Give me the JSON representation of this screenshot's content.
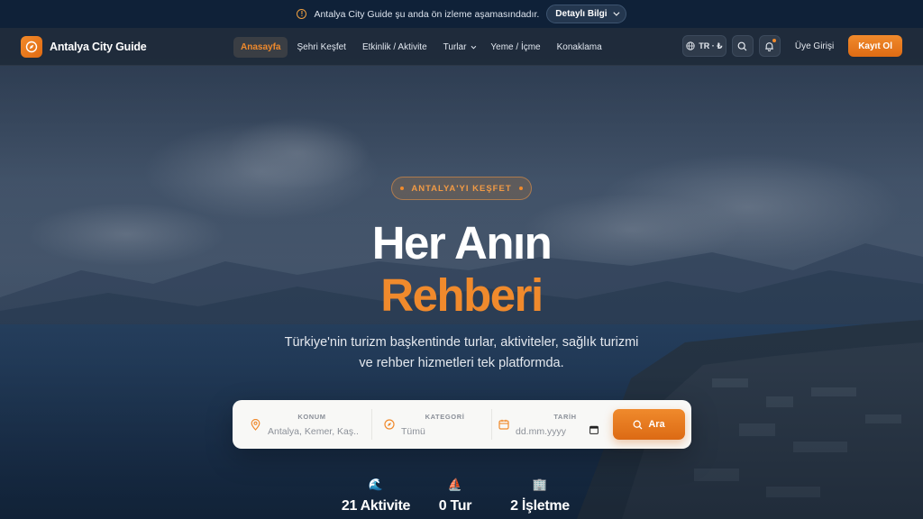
{
  "announcement": {
    "text": "Antalya City Guide şu anda ön izleme aşamasındadır.",
    "button_label": "Detaylı Bilgi"
  },
  "nav": {
    "brand": "Antalya City Guide",
    "items": [
      {
        "label": "Anasayfa",
        "active": true
      },
      {
        "label": "Şehri Keşfet"
      },
      {
        "label": "Etkinlik / Aktivite"
      },
      {
        "label": "Turlar",
        "dropdown": true
      },
      {
        "label": "Yeme / İçme"
      },
      {
        "label": "Konaklama"
      }
    ],
    "lang_label": "TR · ₺",
    "login_label": "Üye Girişi",
    "signup_label": "Kayıt Ol"
  },
  "hero": {
    "badge": "ANTALYA'YI KEŞFET",
    "title_line1": "Her Anın",
    "title_line2": "Rehberi",
    "subtitle": "Türkiye'nin turizm başkentinde turlar, aktiviteler, sağlık turizmi ve rehber hizmetleri tek platformda."
  },
  "search": {
    "location_label": "KONUM",
    "location_placeholder": "Antalya, Kemer, Kaş...",
    "category_label": "KATEGORİ",
    "category_value": "Tümü",
    "date_label": "TARİH",
    "date_placeholder": "dd.mm.yyyy",
    "button_label": "Ara"
  },
  "stats": [
    {
      "icon": "wave-icon",
      "emoji": "🌊",
      "label": "21 Aktivite"
    },
    {
      "icon": "sailboat-icon",
      "emoji": "⛵",
      "label": "0 Tur"
    },
    {
      "icon": "building-icon",
      "emoji": "🏢",
      "label": "2 İşletme"
    }
  ],
  "colors": {
    "accent": "#f08a2c",
    "announce_bg": "#0f2138",
    "nav_bg": "#1e2a3a"
  }
}
